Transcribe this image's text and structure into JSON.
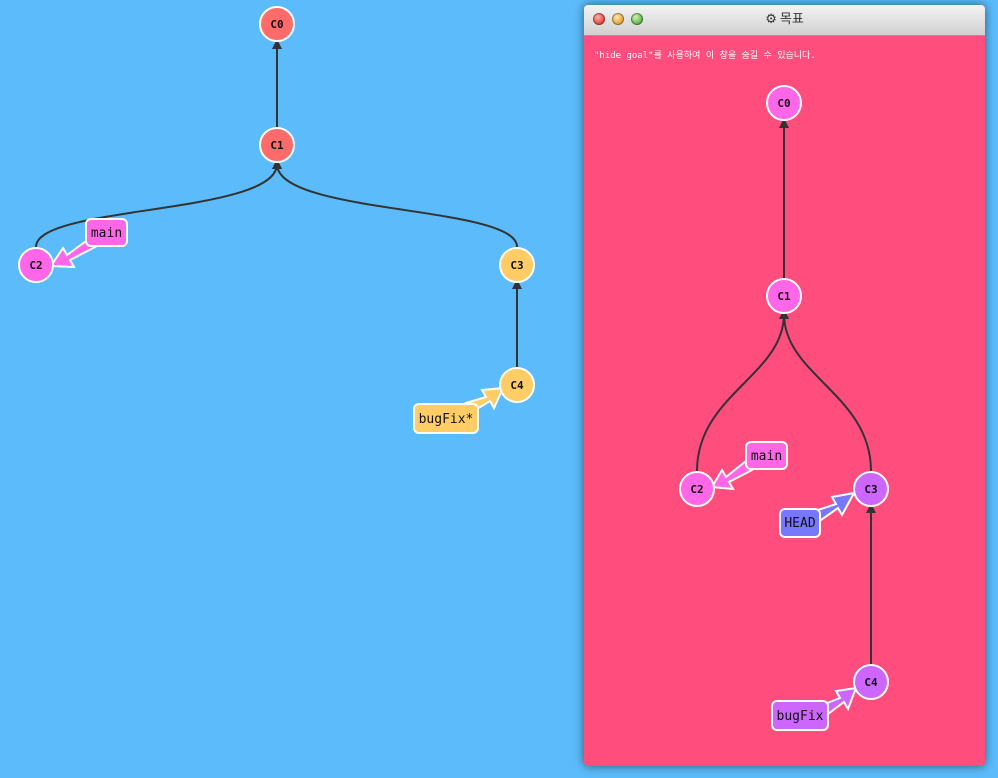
{
  "main_view": {
    "commits": [
      {
        "id": "C0",
        "color": "#ff6b6b"
      },
      {
        "id": "C1",
        "color": "#ff6b6b"
      },
      {
        "id": "C2",
        "color": "#ff66e8"
      },
      {
        "id": "C3",
        "color": "#ffcc66"
      },
      {
        "id": "C4",
        "color": "#ffcc66"
      }
    ],
    "branches": [
      {
        "name": "main",
        "color": "#ff66e8"
      },
      {
        "name": "bugFix*",
        "color": "#ffcc66"
      }
    ]
  },
  "goal_window": {
    "title": "목표",
    "title_icon": "gear-icon",
    "hint": "\"hide goal\"를 사용하여 이 창을 숨길 수 있습니다.",
    "background": "#ff4d7d",
    "commits": [
      {
        "id": "C0",
        "color": "#ff66e8"
      },
      {
        "id": "C1",
        "color": "#ff66e8"
      },
      {
        "id": "C2",
        "color": "#ff66e8"
      },
      {
        "id": "C3",
        "color": "#cc66ff"
      },
      {
        "id": "C4",
        "color": "#cc66ff"
      }
    ],
    "branches": [
      {
        "name": "main",
        "color": "#ff66e8"
      },
      {
        "name": "bugFix",
        "color": "#cc66ff"
      }
    ],
    "head": {
      "name": "HEAD",
      "color": "#7878ff"
    }
  },
  "colors": {
    "background": "#5cbcfb",
    "edge": "#333333"
  }
}
